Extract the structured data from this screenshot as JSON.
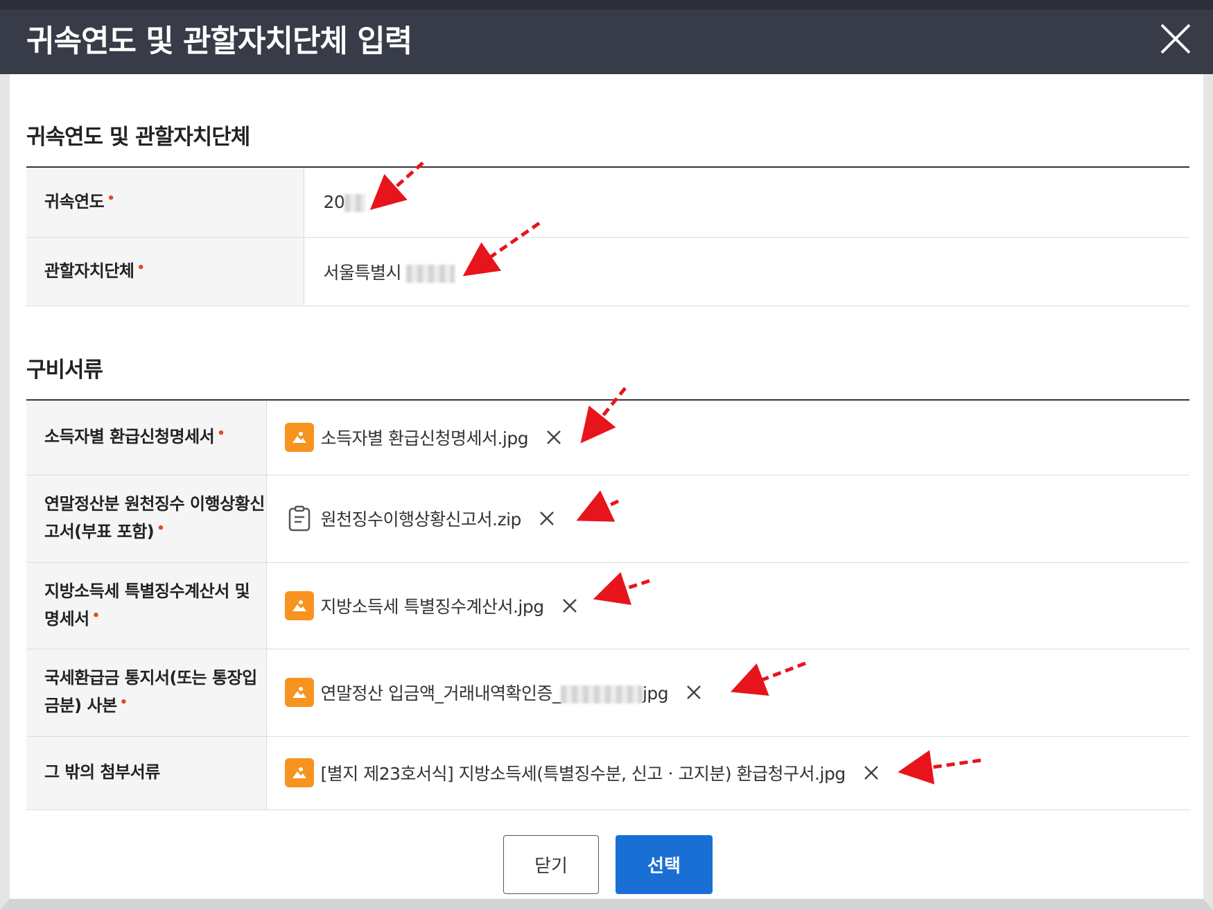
{
  "dialog": {
    "title": "귀속연도 및 관할자치단체 입력"
  },
  "section1": {
    "title": "귀속연도 및 관할자치단체",
    "rows": [
      {
        "label": "귀속연도",
        "value": "20"
      },
      {
        "label": "관할자치단체",
        "value": "서울특별시"
      }
    ]
  },
  "section2": {
    "title": "구비서류",
    "rows": [
      {
        "label": "소득자별 환급신청명세서",
        "file": "소득자별 환급신청명세서.jpg",
        "file_type": "image-icon"
      },
      {
        "label": "연말정산분 원천징수 이행상황신고서(부표 포함)",
        "file": "원천징수이행상황신고서.zip",
        "file_type": "document-icon"
      },
      {
        "label": "지방소득세 특별징수계산서 및 명세서",
        "file": "지방소득세 특별징수계산서.jpg",
        "file_type": "image-icon"
      },
      {
        "label": "국세환급금 통지서(또는 통장입금분) 사본",
        "file_prefix": "연말정산 입금액_거래내역확인증_",
        "file_suffix": "jpg",
        "file_type": "image-icon"
      },
      {
        "label": "그 밖의 첨부서류",
        "file": "[별지 제23호서식] 지방소득세(특별징수분, 신고ㆍ고지분) 환급청구서.jpg",
        "file_type": "image-icon"
      }
    ]
  },
  "required_mark": "•",
  "buttons": {
    "close": "닫기",
    "select": "선택"
  },
  "colors": {
    "header_bg": "#383b48",
    "primary": "#1a6fd4",
    "file_icon": "#f7931e",
    "required": "#e2471f",
    "annotation_arrow": "#e8141c"
  }
}
